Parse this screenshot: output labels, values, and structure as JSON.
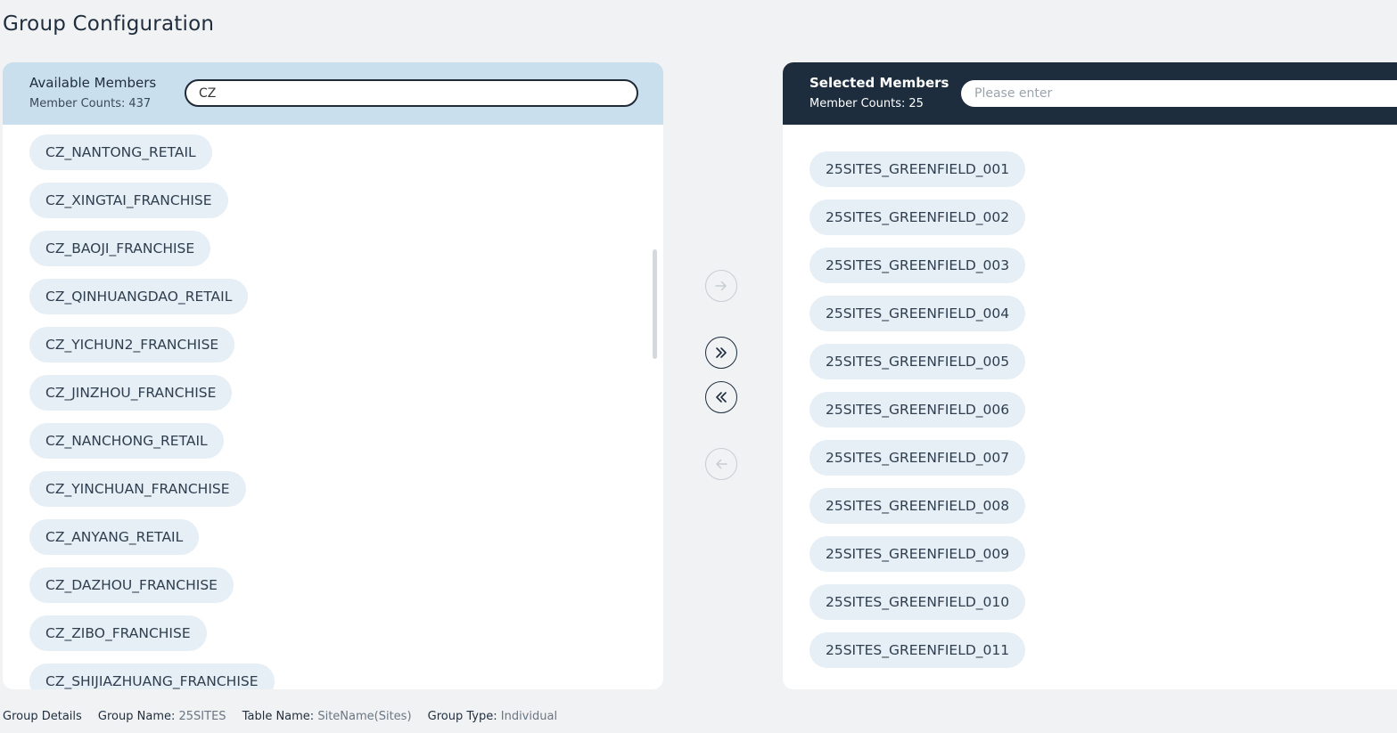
{
  "page_title": "Group Configuration",
  "available": {
    "title": "Available Members",
    "count_label": "Member Counts:",
    "count": "437",
    "search_value": "CZ",
    "items": [
      "CZ_NANTONG_RETAIL",
      "CZ_XINGTAI_FRANCHISE",
      "CZ_BAOJI_FRANCHISE",
      "CZ_QINHUANGDAO_RETAIL",
      "CZ_YICHUN2_FRANCHISE",
      "CZ_JINZHOU_FRANCHISE",
      "CZ_NANCHONG_RETAIL",
      "CZ_YINCHUAN_FRANCHISE",
      "CZ_ANYANG_RETAIL",
      "CZ_DAZHOU_FRANCHISE",
      "CZ_ZIBO_FRANCHISE",
      "CZ_SHIJIAZHUANG_FRANCHISE"
    ]
  },
  "selected": {
    "title": "Selected Members",
    "count_label": "Member Counts:",
    "count": "25",
    "search_placeholder": "Please enter",
    "items": [
      "25SITES_GREENFIELD_001",
      "25SITES_GREENFIELD_002",
      "25SITES_GREENFIELD_003",
      "25SITES_GREENFIELD_004",
      "25SITES_GREENFIELD_005",
      "25SITES_GREENFIELD_006",
      "25SITES_GREENFIELD_007",
      "25SITES_GREENFIELD_008",
      "25SITES_GREENFIELD_009",
      "25SITES_GREENFIELD_010",
      "25SITES_GREENFIELD_011"
    ]
  },
  "transfer_buttons": [
    {
      "name": "move-selected-right-button",
      "icon": "arrow-right-icon",
      "enabled": false
    },
    {
      "name": "move-all-right-button",
      "icon": "double-chevron-right-icon",
      "enabled": true
    },
    {
      "name": "move-all-left-button",
      "icon": "double-chevron-left-icon",
      "enabled": true
    },
    {
      "name": "move-selected-left-button",
      "icon": "arrow-left-icon",
      "enabled": false
    }
  ],
  "footer": {
    "section_label": "Group Details",
    "group_name_label": "Group Name:",
    "group_name": "25SITES",
    "table_name_label": "Table Name:",
    "table_name": "SiteName(Sites)",
    "group_type_label": "Group Type:",
    "group_type": "Individual"
  },
  "colors": {
    "available_header_bg": "#c9dfee",
    "selected_header_bg": "#1d2d3e",
    "chip_bg": "#e6eef6",
    "page_bg": "#f0f2f4"
  }
}
